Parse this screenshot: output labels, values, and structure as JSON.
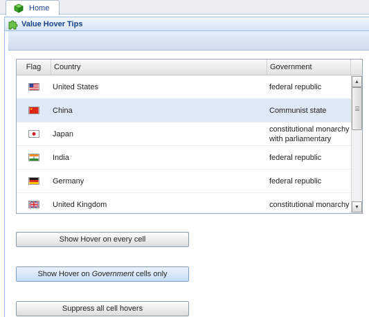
{
  "tab": {
    "label": "Home",
    "icon": "green-cube-icon"
  },
  "panel": {
    "title": "Value Hover Tips",
    "icon": "puzzle-piece-icon"
  },
  "grid": {
    "columns": [
      "Flag",
      "Country",
      "Government"
    ],
    "rows": [
      {
        "flag": "us-flag-icon",
        "country": "United States",
        "government": "federal republic"
      },
      {
        "flag": "china-flag-icon",
        "country": "China",
        "government": "Communist state"
      },
      {
        "flag": "japan-flag-icon",
        "country": "Japan",
        "government": "constitutional monarchy with parliamentary"
      },
      {
        "flag": "india-flag-icon",
        "country": "India",
        "government": "federal republic"
      },
      {
        "flag": "germany-flag-icon",
        "country": "Germany",
        "government": "federal republic"
      },
      {
        "flag": "uk-flag-icon",
        "country": "United Kingdom",
        "government": "constitutional monarchy"
      }
    ],
    "selected_row": 1
  },
  "buttons": {
    "every_cell": "Show Hover on every cell",
    "gov_prefix": "Show Hover on ",
    "gov_emph": "Government",
    "gov_suffix": " cells only",
    "suppress": "Suppress all cell hovers"
  },
  "colors": {
    "accent": "#15428b",
    "panel_border": "#99bbe8",
    "selected_row": "#dfe8f6"
  }
}
